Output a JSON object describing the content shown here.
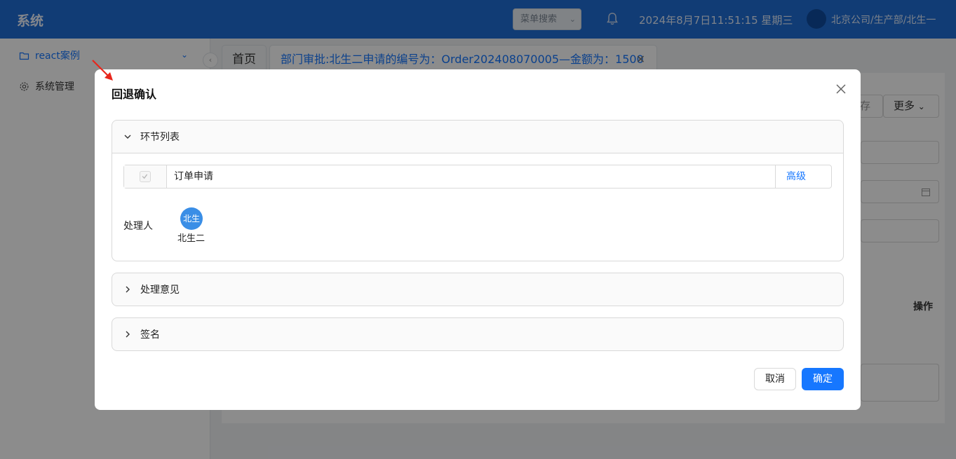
{
  "header": {
    "brand": "系统",
    "menu_search": "菜单搜索",
    "datetime": "2024年8月7日11:51:15 星期三",
    "user_path": "北京公司/生产部/北生一"
  },
  "sidebar": {
    "items": [
      {
        "label": "react案例",
        "icon": "folder-icon"
      },
      {
        "label": "系统管理",
        "icon": "gear-icon"
      }
    ]
  },
  "tabs": [
    {
      "label": "首页"
    },
    {
      "label": "部门审批:北生二申请的编号为：Order202408070005—金额为：1500"
    }
  ],
  "background": {
    "partial_button": "存",
    "more_button": "更多",
    "column_action": "操作"
  },
  "modal": {
    "title": "回退确认",
    "panels": [
      {
        "title": "环节列表",
        "expanded": true
      },
      {
        "title": "处理意见",
        "expanded": false
      },
      {
        "title": "签名",
        "expanded": false
      }
    ],
    "node": {
      "name": "订单申请",
      "advanced": "高级",
      "checked": true
    },
    "handler": {
      "label": "处理人",
      "avatar_text": "北生",
      "name": "北生二"
    },
    "cancel": "取消",
    "confirm": "确定"
  },
  "colors": {
    "header": "#1f6dd6",
    "primary": "#1677ff",
    "avatar": "#3a8ee6",
    "annotation_arrow": "#e8261c"
  }
}
